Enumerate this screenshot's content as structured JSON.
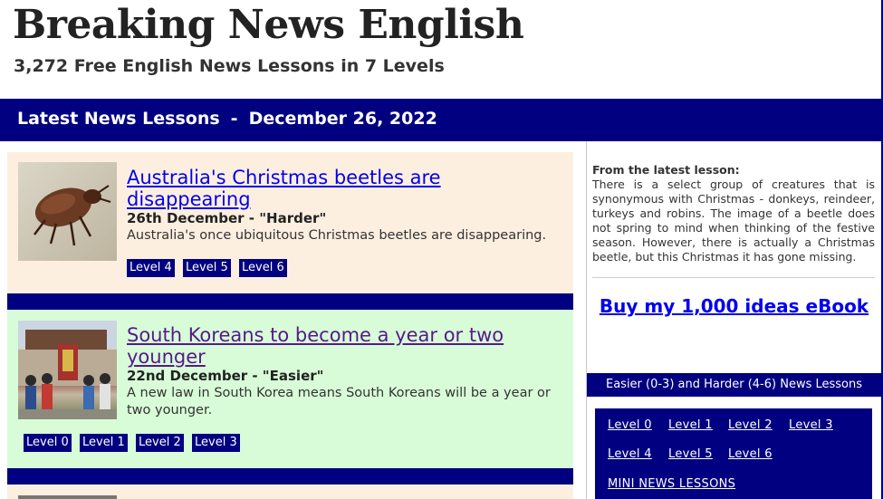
{
  "site": {
    "title": "Breaking News English",
    "subtitle": "3,272 Free English News Lessons in 7 Levels"
  },
  "banner": {
    "label": "Latest News Lessons",
    "separator": "-",
    "date": "December 26, 2022"
  },
  "articles": [
    {
      "title": "Australia's Christmas beetles are disappearing",
      "date": "26th December - \"Harder\"",
      "summary": "Australia's once ubiquitous Christmas beetles are disappearing.",
      "image": "christmas-beetle-photo",
      "levels": [
        "Level 4",
        "Level 5",
        "Level 6"
      ]
    },
    {
      "title": "South Koreans to become a year or two younger",
      "date": "22nd December - \"Easier\"",
      "summary": "A new law in South Korea means South Koreans will be a year or two younger.",
      "image": "korean-ceremony-photo",
      "levels": [
        "Level 0",
        "Level 1",
        "Level 2",
        "Level 3"
      ]
    }
  ],
  "sidebar": {
    "quote_label": "From the latest lesson:",
    "quote_text": "There is a select group of creatures that is synonymous with Christmas - donkeys, reindeer, turkeys and robins. The image of a beetle does not spring to mind when thinking of the festive season. However, there is actually a Christmas beetle, but this Christmas it has gone missing.",
    "ebook_link": "Buy my 1,000 ideas eBook",
    "lessons_bar": "Easier (0-3)  and  Harder (4-6) News Lessons",
    "level_links": [
      "Level 0",
      "Level 1",
      "Level 2",
      "Level 3",
      "Level 4",
      "Level 5",
      "Level 6"
    ],
    "mini_link": "MINI NEWS LESSONS"
  },
  "colors": {
    "navy": "#000080",
    "card_peach": "#fdefe0",
    "card_green": "#d8fcd8",
    "link_blue": "#0000ee",
    "visited_purple": "#551a8b"
  }
}
